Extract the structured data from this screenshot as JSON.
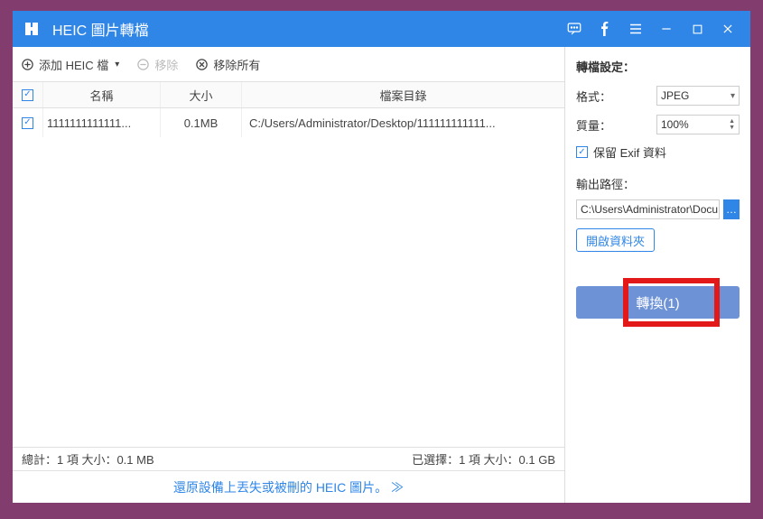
{
  "window": {
    "title": "HEIC 圖片轉檔"
  },
  "toolbar": {
    "add_label": "添加 HEIC 檔",
    "remove_label": "移除",
    "remove_all_label": "移除所有"
  },
  "columns": {
    "name": "名稱",
    "size": "大小",
    "path": "檔案目錄"
  },
  "files": [
    {
      "name": "1111111111111...",
      "size": "0.1MB",
      "path": "C:/Users/Administrator/Desktop/111111111111..."
    }
  ],
  "status": {
    "total": "總計：1 項 大小：0.1 MB",
    "selected": "已選擇：1 項 大小：0.1 GB"
  },
  "footer": {
    "recover": "還原設備上丟失或被刪的 HEIC 圖片。 ≫"
  },
  "settings": {
    "title": "轉檔設定：",
    "format_label": "格式：",
    "format_value": "JPEG",
    "quality_label": "質量：",
    "quality_value": "100%",
    "keep_exif": "保留 Exif 資料",
    "output_label": "輸出路徑：",
    "output_path": "C:\\Users\\Administrator\\Docu",
    "open_folder": "開啟資料夾",
    "convert": "轉換(1)"
  }
}
